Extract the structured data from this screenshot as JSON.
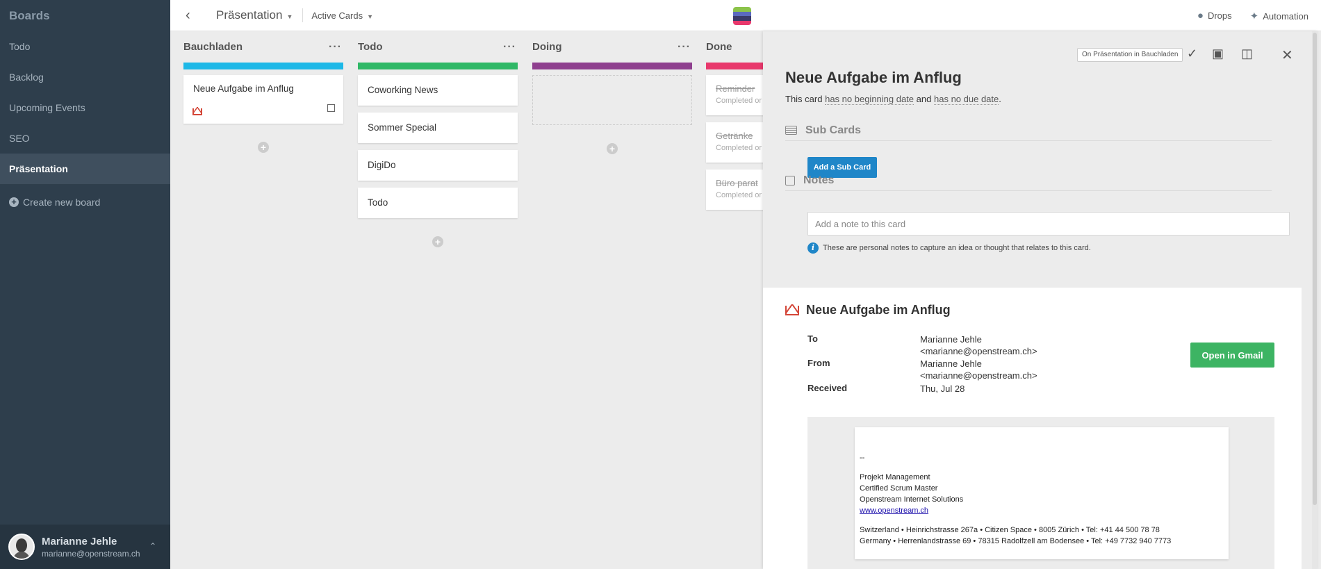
{
  "sidebar": {
    "title": "Boards",
    "items": [
      {
        "label": "Todo"
      },
      {
        "label": "Backlog"
      },
      {
        "label": "Upcoming Events"
      },
      {
        "label": "SEO"
      },
      {
        "label": "Präsentation"
      }
    ],
    "create_label": "Create new board",
    "user": {
      "name": "Marianne Jehle",
      "email": "marianne@openstream.ch"
    }
  },
  "topbar": {
    "board_name": "Präsentation",
    "filter": "Active Cards",
    "drops": "Drops",
    "automation": "Automation"
  },
  "lists": [
    {
      "title": "Bauchladen",
      "color": "#1db8e7",
      "cards": [
        "Neue Aufgabe im Anflug"
      ]
    },
    {
      "title": "Todo",
      "color": "#2fb866",
      "cards": [
        "Coworking News",
        "Sommer Special",
        "DigiDo",
        "Todo"
      ]
    },
    {
      "title": "Doing",
      "color": "#8e3f8e",
      "cards": []
    },
    {
      "title": "Done",
      "color": "#e8386c",
      "cards": [
        {
          "title": "Reminder",
          "sub": "Completed or"
        },
        {
          "title": "Getränke",
          "sub": "Completed or"
        },
        {
          "title": "Büro parat",
          "sub": "Completed or"
        }
      ]
    }
  ],
  "detail": {
    "location_badge": "On Präsentation in Bauchladen",
    "title": "Neue Aufgabe im Anflug",
    "dates": {
      "prefix": "This card",
      "begin": "has no beginning date",
      "and": "and",
      "due": "has no due date",
      "suffix": "."
    },
    "subcards_label": "Sub Cards",
    "add_subcard": "Add a Sub Card",
    "notes_label": "Notes",
    "note_placeholder": "Add a note to this card",
    "notes_info": "These are personal notes to capture an idea or thought that relates to this card.",
    "email": {
      "title": "Neue Aufgabe im Anflug",
      "to_label": "To",
      "to_name": "Marianne Jehle",
      "to_addr": "<marianne@openstream.ch>",
      "from_label": "From",
      "from_name": "Marianne Jehle",
      "from_addr": "<marianne@openstream.ch>",
      "received_label": "Received",
      "received": "Thu, Jul 28",
      "open_button": "Open in Gmail",
      "body": {
        "sep": "--",
        "line1": "Projekt Management",
        "line2": "Certified Scrum Master",
        "line3": "Openstream Internet Solutions",
        "link": "www.openstream.ch",
        "addr1": "Switzerland • Heinrichstrasse 267a • Citizen Space • 8005 Zürich • Tel: +41 44 500 78 78",
        "addr2": "Germany • Herrenlandstrasse 69 • 78315 Radolfzell am Bodensee • Tel: +49 7732 940 7773"
      }
    }
  },
  "icons": {
    "logo_colors": [
      "#8bc34a",
      "#5b6abf",
      "#3a3a6a",
      "#e8386c"
    ]
  }
}
